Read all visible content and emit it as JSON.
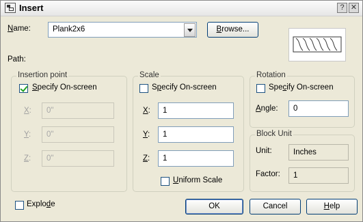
{
  "window": {
    "title": "Insert",
    "help_glyph": "?",
    "close_glyph": "✕"
  },
  "name": {
    "label_u": "N",
    "label_rest": "ame:",
    "value": "Plank2x6"
  },
  "browse_button": {
    "label_u": "B",
    "label_rest": "rowse..."
  },
  "path": {
    "label": "Path:"
  },
  "insertion_point": {
    "title": "Insertion point",
    "checkbox_pre": "",
    "checkbox_u": "S",
    "checkbox_post": "pecify On-screen",
    "checked": true,
    "x_label_u": "X",
    "x_label_rest": ":",
    "x_value": "0\"",
    "y_label_u": "Y",
    "y_label_rest": ":",
    "y_value": "0\"",
    "z_label_u": "Z",
    "z_label_rest": ":",
    "z_value": "0\""
  },
  "scale": {
    "title": "Scale",
    "checkbox_pre": "S",
    "checkbox_u": "p",
    "checkbox_post": "ecify On-screen",
    "checked": false,
    "x_label_u": "X",
    "x_label_rest": ":",
    "x_value": "1",
    "y_label_u": "Y",
    "y_label_rest": ":",
    "y_value": "1",
    "z_label_u": "Z",
    "z_label_rest": ":",
    "z_value": "1",
    "uniform_u": "U",
    "uniform_rest": "niform Scale",
    "uniform_checked": false
  },
  "rotation": {
    "title": "Rotation",
    "checkbox_pre": "Spe",
    "checkbox_u": "c",
    "checkbox_post": "ify On-screen",
    "checked": false,
    "angle_label_u": "A",
    "angle_label_rest": "ngle:",
    "angle_value": "0"
  },
  "block_unit": {
    "title": "Block Unit",
    "unit_label": "Unit:",
    "unit_value": "Inches",
    "factor_label": "Factor:",
    "factor_value": "1"
  },
  "explode": {
    "label_pre": "Explo",
    "label_u": "d",
    "label_post": "e",
    "checked": false
  },
  "buttons": {
    "ok": "OK",
    "cancel": "Cancel",
    "help_u": "H",
    "help_rest": "elp"
  },
  "colors": {
    "dialog_bg": "#ece9d8",
    "field_border": "#7f9db9",
    "button_border": "#003c74",
    "check_color": "#21a121"
  }
}
